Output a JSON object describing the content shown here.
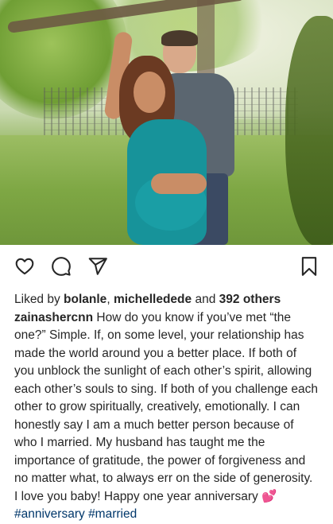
{
  "post": {
    "liked_by_prefix": "Liked by",
    "liked_user_1": "bolanle",
    "liked_separator": ",",
    "liked_user_2": "michelledede",
    "liked_and": "and",
    "others_count": "392 others",
    "author": "zainashercnn",
    "caption": "How do you know if you’ve met “the one?” Simple. If, on some level, your relationship has made the world around you a better place. If both of you unblock the sunlight of each other’s spirit, allowing each other’s souls to sing. If both of you challenge each other to grow spiritually, creatively, emotionally. I can honestly say I am a much better person because of who I married. My husband has taught me the importance of gratitude, the power of forgiveness and no matter what, to always err on the side of generosity. I love you baby! Happy one year anniversary",
    "emoji": "💕",
    "hashtag_1": "#anniversary",
    "hashtag_2": "#married"
  },
  "icons": {
    "like": "heart-icon",
    "comment": "comment-icon",
    "share": "paper-plane-icon",
    "save": "bookmark-icon"
  },
  "colors": {
    "text": "#262626",
    "hashtag": "#00376b",
    "dress": "#17939a"
  }
}
